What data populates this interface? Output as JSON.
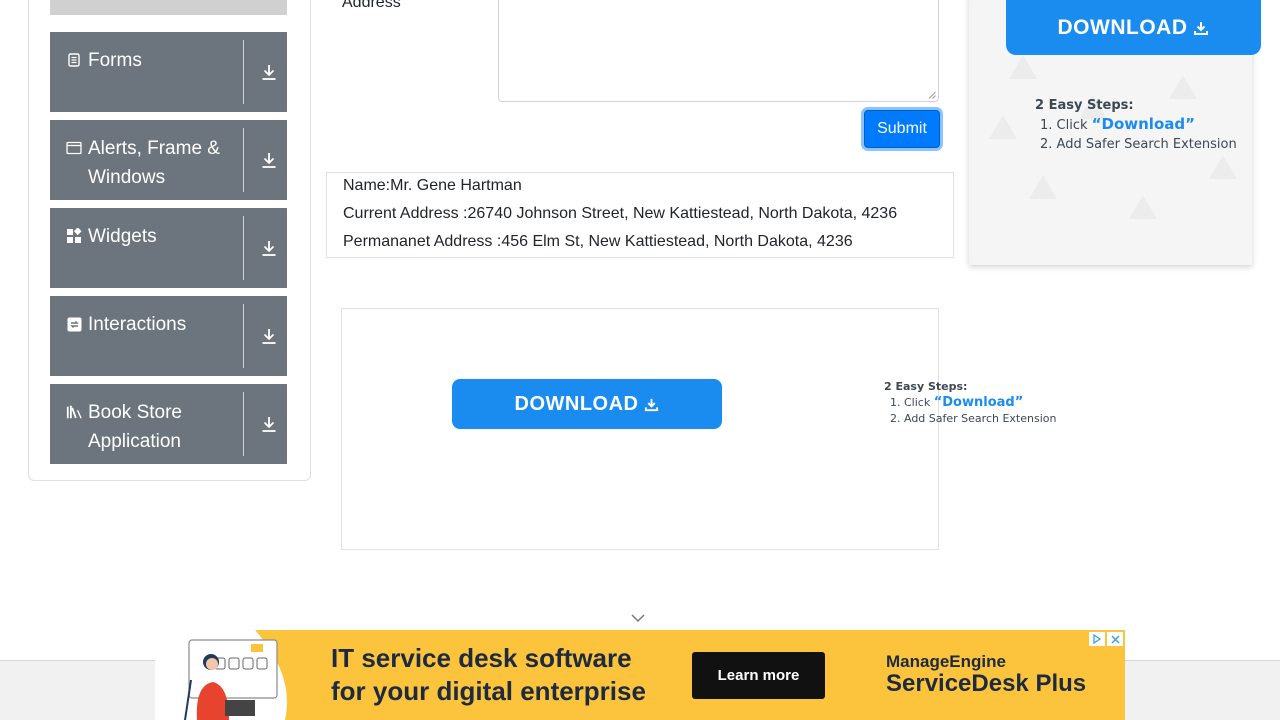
{
  "sidebar": {
    "items": [
      {
        "label": "Forms",
        "icon": "form-icon"
      },
      {
        "label": "Alerts, Frame & Windows",
        "icon": "window-icon"
      },
      {
        "label": "Widgets",
        "icon": "widgets-icon"
      },
      {
        "label": "Interactions",
        "icon": "interactions-icon"
      },
      {
        "label": "Book Store Application",
        "icon": "book-icon"
      }
    ]
  },
  "form": {
    "address_label": "Address",
    "submit_label": "Submit"
  },
  "output": {
    "name": "Name:Mr. Gene Hartman",
    "current_address": "Current Address :26740 Johnson Street, New Kattiestead, North Dakota, 4236",
    "permanent_address": "Permananet Address :456 Elm St, New Kattiestead, North Dakota, 4236"
  },
  "ad_right": {
    "download_label": "DOWNLOAD",
    "steps_title": "2 Easy Steps:",
    "step1_prefix": "1. Click ",
    "step1_link": "“Download”",
    "step2": "2. Add Safer Search Extension"
  },
  "ad_center": {
    "download_label": "DOWNLOAD",
    "steps_title": "2 Easy Steps:",
    "step1_prefix": "1. Click ",
    "step1_link": "“Download”",
    "step2": "2. Add Safer Search Extension"
  },
  "banner": {
    "headline_1": "IT service desk software",
    "headline_2": "for your digital enterprise",
    "cta": "Learn more",
    "brand_1": "ManageEngine",
    "brand_2": "ServiceDesk Plus"
  },
  "colors": {
    "sidebar_bg": "#6c757d",
    "primary": "#007bff",
    "ad_blue": "#1a8cf0",
    "banner_bg": "#fcc33c"
  }
}
